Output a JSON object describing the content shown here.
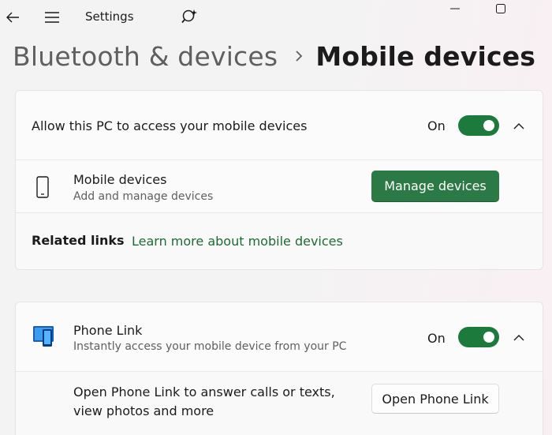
{
  "titlebar": {
    "app_title": "Settings",
    "icons": [
      "back-arrow-icon",
      "hamburger-menu-icon",
      "search-icon",
      "minimize-icon",
      "maximize-icon"
    ]
  },
  "breadcrumb": {
    "parent": "Bluetooth & devices",
    "current": "Mobile devices"
  },
  "allow_access": {
    "label": "Allow this PC to access your mobile devices",
    "state_label": "On",
    "enabled": true
  },
  "mobile_devices": {
    "title": "Mobile devices",
    "subtitle": "Add and manage devices",
    "button": "Manage devices"
  },
  "related_links": {
    "heading": "Related links",
    "link": "Learn more about mobile devices"
  },
  "phone_link": {
    "title": "Phone Link",
    "subtitle": "Instantly access your mobile device from your PC",
    "state_label": "On",
    "enabled": true,
    "open_text_line1": "Open Phone Link to answer calls or texts,",
    "open_text_line2": "view photos and more",
    "button": "Open Phone Link"
  },
  "colors": {
    "accent": "#2b7a46",
    "toggle_on": "#1c7a3d",
    "link": "#1c6b36"
  }
}
